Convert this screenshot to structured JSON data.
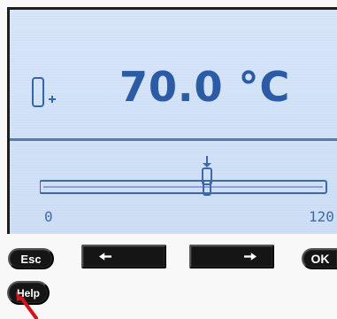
{
  "display": {
    "temperature": "70.0 °C",
    "range_min": "0",
    "range_max": "120",
    "slider_value": 70,
    "slider_max": 120,
    "icon_name": "sensor-probe-icon",
    "text_color": "#2c5ba6",
    "lcd_color": "#c9dcf6"
  },
  "controls": {
    "esc_label": "Esc",
    "ok_label": "OK",
    "help_label": "Help",
    "left_icon": "arrow-left-icon",
    "right_icon": "arrow-right-icon",
    "button_color": "#151515",
    "pointer_color": "#d01616"
  }
}
